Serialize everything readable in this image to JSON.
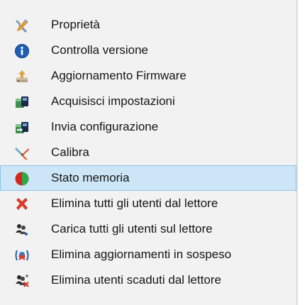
{
  "menu": {
    "items": [
      {
        "label": "Proprietà",
        "icon": "wrench-screwdriver-icon"
      },
      {
        "label": "Controlla versione",
        "icon": "info-icon"
      },
      {
        "label": "Aggiornamento Firmware",
        "icon": "firmware-update-icon"
      },
      {
        "label": "Acquisisci impostazioni",
        "icon": "acquire-settings-icon"
      },
      {
        "label": "Invia configurazione",
        "icon": "send-configuration-icon"
      },
      {
        "label": "Calibra",
        "icon": "calibrate-icon"
      },
      {
        "label": "Stato memoria",
        "icon": "memory-pie-icon",
        "selected": true
      },
      {
        "label": "Elimina tutti gli utenti dal lettore",
        "icon": "delete-x-icon"
      },
      {
        "label": "Carica tutti gli utenti sul lettore",
        "icon": "upload-users-icon"
      },
      {
        "label": "Elimina aggiornamenti in sospeso",
        "icon": "delete-pending-updates-icon"
      },
      {
        "label": "Elimina utenti scaduti dal lettore",
        "icon": "delete-expired-users-icon"
      }
    ],
    "colors": {
      "selection_bg": "#cde6f7",
      "selection_border": "#8ec4ea",
      "menu_bg": "#f2f2f2"
    }
  }
}
